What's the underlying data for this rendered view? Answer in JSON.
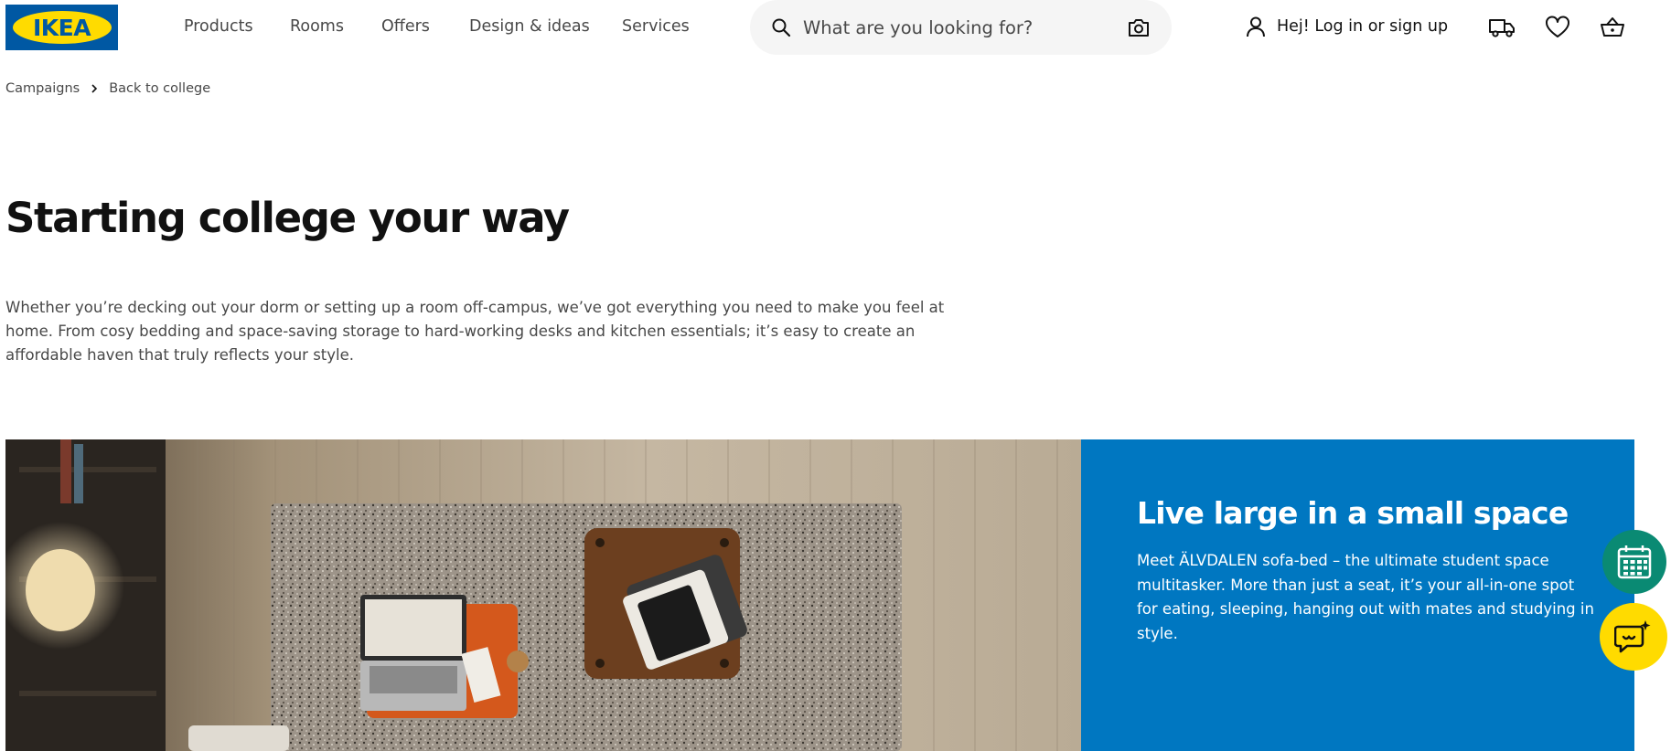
{
  "header": {
    "logo_text": "IKEA",
    "nav": [
      "Products",
      "Rooms",
      "Offers",
      "Design & ideas",
      "Services"
    ],
    "search": {
      "placeholder": "What are you looking for?"
    },
    "login_label": "Hej! Log in or sign up",
    "icons": [
      "user-icon",
      "truck-icon",
      "heart-icon",
      "basket-icon"
    ]
  },
  "breadcrumb": [
    "Campaigns",
    "Back to college"
  ],
  "intro": {
    "title": "Starting college your way",
    "body": "Whether you’re decking out your dorm or setting up a room off-campus, we’ve got everything you need to make you feel at home. From cosy bedding and space-saving storage to hard-working desks and kitchen essentials; it’s easy to create an affordable haven that truly reflects your style."
  },
  "hero": {
    "title": "Live large in a small space",
    "body": "Meet ÄLVDALEN sofa-bed – the ultimate student space multitasker. More than just a seat, it’s your all-in-one spot for eating, sleeping, hanging out with mates and studying in style."
  },
  "floating_buttons": [
    "calendar-icon",
    "chat-icon"
  ],
  "colors": {
    "brand_blue": "#0058a3",
    "brand_yellow": "#ffdb00",
    "hero_panel": "#0077c1",
    "calendar_fab": "#0a8a73",
    "text": "#111111",
    "muted_text": "#484848",
    "search_bg": "#f5f5f5"
  }
}
